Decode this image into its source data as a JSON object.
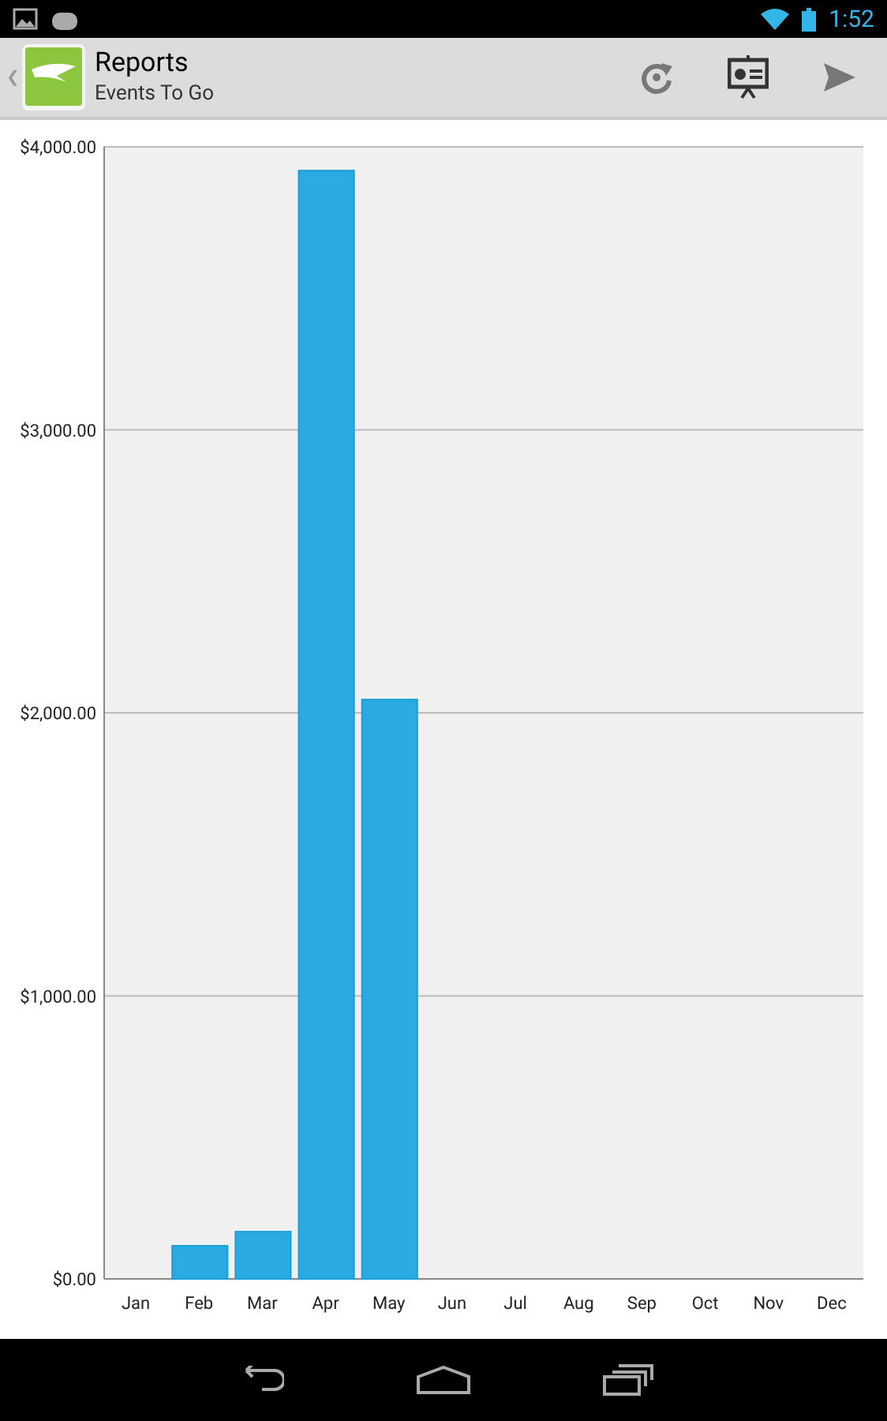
{
  "status_bar": {
    "time": "1:52"
  },
  "action_bar": {
    "title": "Reports",
    "subtitle": "Events To Go",
    "back_glyph": "❮"
  },
  "chart": {
    "chart_data": {
      "type": "bar",
      "categories": [
        "Jan",
        "Feb",
        "Mar",
        "Apr",
        "May",
        "Jun",
        "Jul",
        "Aug",
        "Sep",
        "Oct",
        "Nov",
        "Dec"
      ],
      "grid": true,
      "series": [
        {
          "color": "#29abe2",
          "values": [
            0,
            117,
            167,
            3916,
            2047,
            0,
            0,
            0,
            0,
            0,
            0,
            0
          ]
        }
      ],
      "ylim": [
        0,
        4000
      ],
      "yticks": [
        {
          "value": 0,
          "label": "$0.00"
        },
        {
          "value": 1000,
          "label": "$1,000.00"
        },
        {
          "value": 2000,
          "label": "$2,000.00"
        },
        {
          "value": 3000,
          "label": "$3,000.00"
        },
        {
          "value": 4000,
          "label": "$4,000.00"
        }
      ]
    }
  }
}
